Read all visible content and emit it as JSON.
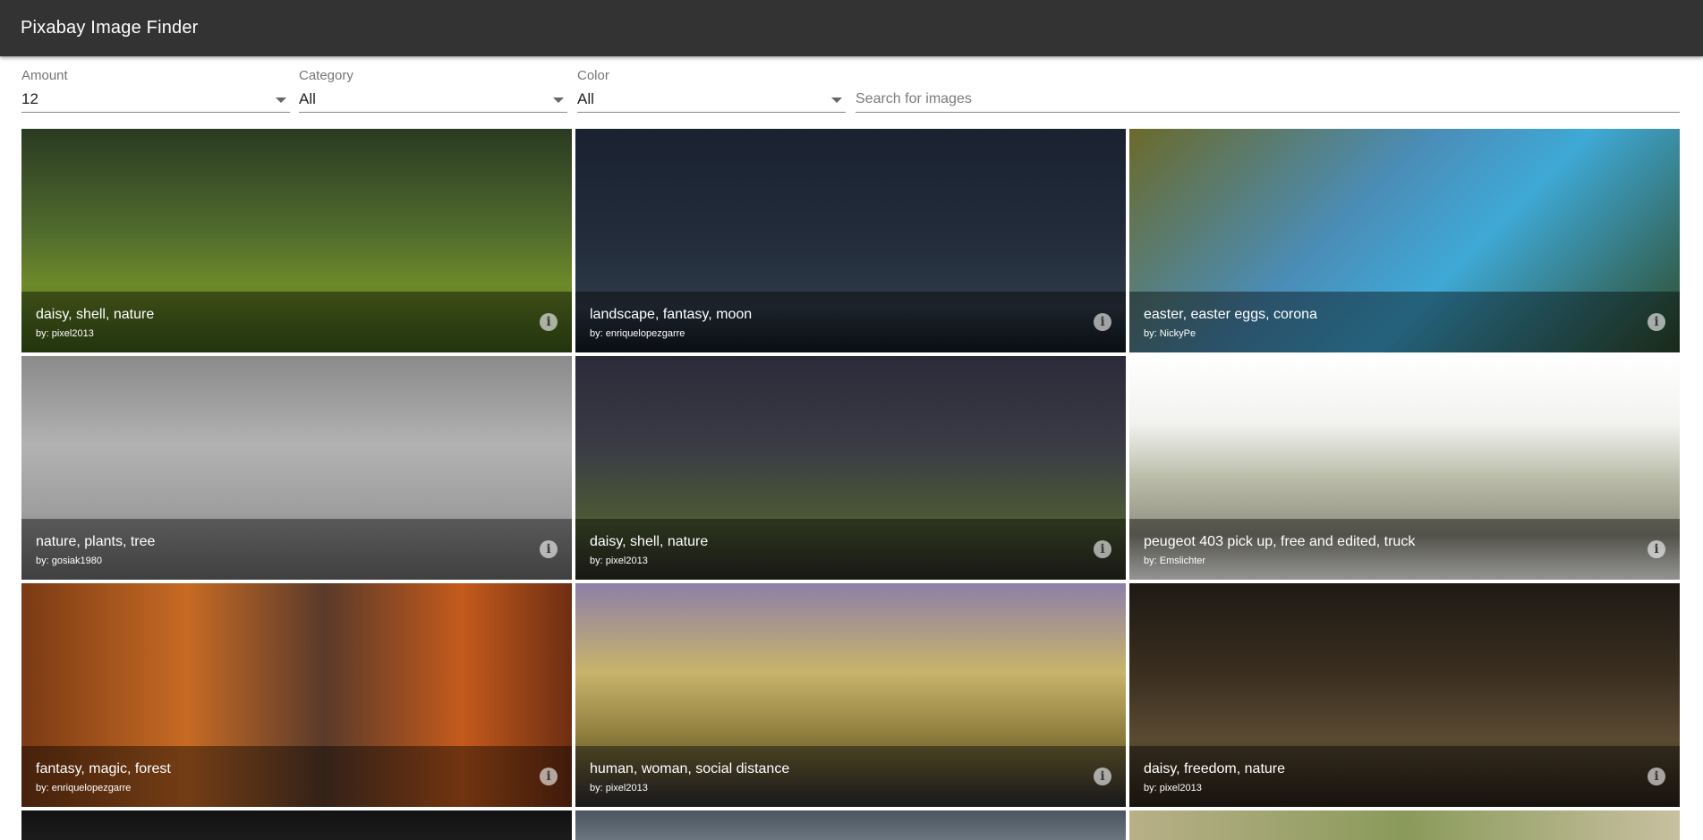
{
  "app": {
    "title": "Pixabay Image Finder"
  },
  "filters": {
    "amount": {
      "label": "Amount",
      "value": "12"
    },
    "category": {
      "label": "Category",
      "value": "All"
    },
    "color": {
      "label": "Color",
      "value": "All"
    },
    "search": {
      "placeholder": "Search for images",
      "value": ""
    }
  },
  "images": [
    {
      "title": "daisy, shell, nature",
      "author": "by: pixel2013"
    },
    {
      "title": "landscape, fantasy, moon",
      "author": "by: enriquelopezgarre"
    },
    {
      "title": "easter, easter eggs, corona",
      "author": "by: NickyPe"
    },
    {
      "title": "nature, plants, tree",
      "author": "by: gosiak1980"
    },
    {
      "title": "daisy, shell, nature",
      "author": "by: pixel2013"
    },
    {
      "title": "peugeot 403 pick up, free and edited, truck",
      "author": "by: Emslichter"
    },
    {
      "title": "fantasy, magic, forest",
      "author": "by: enriquelopezgarre"
    },
    {
      "title": "human, woman, social distance",
      "author": "by: pixel2013"
    },
    {
      "title": "daisy, freedom, nature",
      "author": "by: pixel2013"
    }
  ],
  "info_icon": "info-icon"
}
